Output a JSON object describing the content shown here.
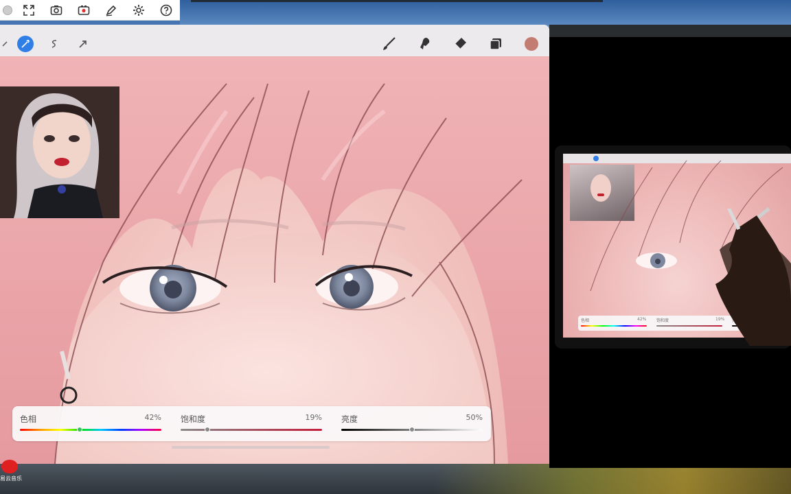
{
  "system_toolbar": {
    "icons": [
      "fullscreen-icon",
      "screenshot-icon",
      "record-icon",
      "pen-icon",
      "settings-icon",
      "help-icon"
    ]
  },
  "procreate": {
    "top_tools_left": [
      "actions-icon",
      "adjustments-icon",
      "selection-icon",
      "transform-icon"
    ],
    "top_tools_right": [
      "brush-icon",
      "smudge-icon",
      "eraser-icon",
      "layers-icon",
      "color-icon"
    ],
    "current_color": "#c27c72",
    "sliders": [
      {
        "label": "色相",
        "value": "42%",
        "fraction": 0.42
      },
      {
        "label": "饱和度",
        "value": "19%",
        "fraction": 0.19
      },
      {
        "label": "亮度",
        "value": "50%",
        "fraction": 0.5
      }
    ]
  },
  "tablet_view": {
    "sliders": [
      {
        "label": "色相",
        "value": "42%"
      },
      {
        "label": "饱和度",
        "value": "19%"
      },
      {
        "label": "亮度",
        "value": ""
      }
    ]
  },
  "taskbar": {
    "app_name": "易云音乐"
  }
}
